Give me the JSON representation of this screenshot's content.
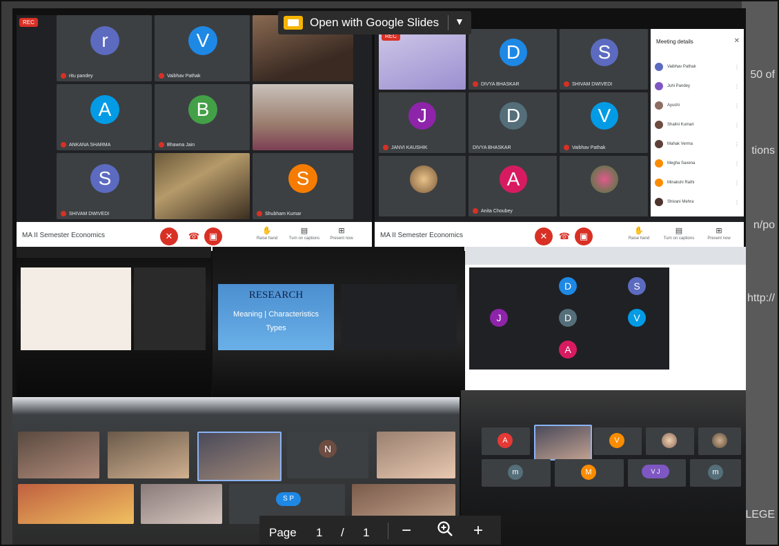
{
  "viewer": {
    "open_with_label": "Open with Google Slides",
    "page_label": "Page",
    "current_page": "1",
    "page_separator": "/",
    "total_pages": "1",
    "zoom_out_icon": "minus-icon",
    "zoom_in_glyph": "+"
  },
  "backdrop": {
    "items": [
      "50 of",
      "tions",
      "n/po",
      "http://",
      "LEGE"
    ]
  },
  "meet_left": {
    "rec": "REC",
    "class_title": "MA II Semester Economics",
    "tiles": [
      {
        "letter": "r",
        "color": "#5c6bc0",
        "name": "ritu pandey"
      },
      {
        "letter": "V",
        "color": "#1e88e5",
        "name": "Vaibhav Pathak"
      },
      {
        "letter": "A",
        "color": "#039be5",
        "name": "ANKANA SHARMA"
      },
      {
        "letter": "B",
        "color": "#43a047",
        "name": "Bhawna Jain"
      },
      {
        "letter": "S",
        "color": "#5c6bc0",
        "name": "SHIVAM DWIVEDI"
      },
      {
        "letter": "S",
        "color": "#f57c00",
        "name": "Shubham Kumar"
      }
    ],
    "controls": [
      "Raise hand",
      "Turn on captions",
      "Present now"
    ]
  },
  "meet_right": {
    "rec": "REC",
    "class_title": "MA II Semester Economics",
    "tiles": [
      {
        "letter": "D",
        "color": "#1e88e5",
        "name": "DIVYA BHASKAR"
      },
      {
        "letter": "S",
        "color": "#5c6bc0",
        "name": "SHIVAM DWIVEDI"
      },
      {
        "letter": "J",
        "color": "#8e24aa",
        "name": "JANVI KAUSHIK"
      },
      {
        "letter": "D",
        "color": "#546e7a",
        "name": "DIVYA BHASKAR"
      },
      {
        "letter": "V",
        "color": "#039be5",
        "name": "Vaibhav Pathak"
      },
      {
        "letter": "A",
        "color": "#d81b60",
        "name": "Anita Choubey"
      }
    ],
    "panel_title": "Meeting details",
    "participants": [
      {
        "name": "Vaibhav Pathak",
        "color": "#5c6bc0"
      },
      {
        "name": "Juhi Pandey",
        "color": "#7e57c2"
      },
      {
        "name": "Ayushi",
        "color": "#8d6e63"
      },
      {
        "name": "Shalini Kumari",
        "color": "#6d4c41"
      },
      {
        "name": "Mahak Verma",
        "color": "#5d4037"
      },
      {
        "name": "Megha Saxena",
        "color": "#fb8c00"
      },
      {
        "name": "Minakshi Rathi",
        "color": "#fb8c00"
      },
      {
        "name": "Shivani Mehra",
        "color": "#4e342e"
      }
    ],
    "controls": [
      "Raise hand",
      "Turn on captions",
      "Present now"
    ]
  },
  "slide_text": {
    "line1": "RESEARCH",
    "line2": "Meaning | Characteristics",
    "line3": "Types"
  },
  "colors": {
    "meet_bg": "#202124",
    "tile_bg": "#3c4043",
    "end_call": "#d93025",
    "slides_yellow": "#f4b400"
  }
}
